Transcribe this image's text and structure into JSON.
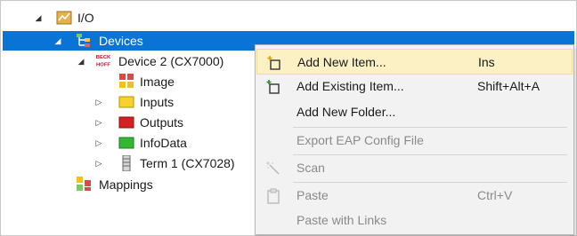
{
  "tree": {
    "io_label": "I/O",
    "devices_label": "Devices",
    "device2_label": "Device 2 (CX7000)",
    "image_label": "Image",
    "inputs_label": "Inputs",
    "outputs_label": "Outputs",
    "infodata_label": "InfoData",
    "term1_label": "Term 1 (CX7028)",
    "mappings_label": "Mappings",
    "beckhoff_logo_text": "BECK HOFF"
  },
  "context_menu": {
    "items": [
      {
        "label": "Add New Item...",
        "shortcut": "Ins",
        "enabled": true,
        "highlighted": true,
        "icon": "add-new-item-icon"
      },
      {
        "label": "Add Existing Item...",
        "shortcut": "Shift+Alt+A",
        "enabled": true,
        "icon": "add-existing-item-icon"
      },
      {
        "label": "Add New Folder...",
        "shortcut": "",
        "enabled": true
      },
      {
        "label": "Export EAP Config File",
        "shortcut": "",
        "enabled": false
      },
      {
        "label": "Scan",
        "shortcut": "",
        "enabled": false,
        "icon": "scan-wand-icon"
      },
      {
        "label": "Paste",
        "shortcut": "Ctrl+V",
        "enabled": false,
        "icon": "paste-clipboard-icon"
      },
      {
        "label": "Paste with Links",
        "shortcut": "",
        "enabled": false
      }
    ]
  },
  "colors": {
    "selection": "#0a74d6",
    "menu_highlight": "#fcf1c5",
    "menu_background": "#f2f2f2",
    "disabled_text": "#8a8a8a"
  }
}
